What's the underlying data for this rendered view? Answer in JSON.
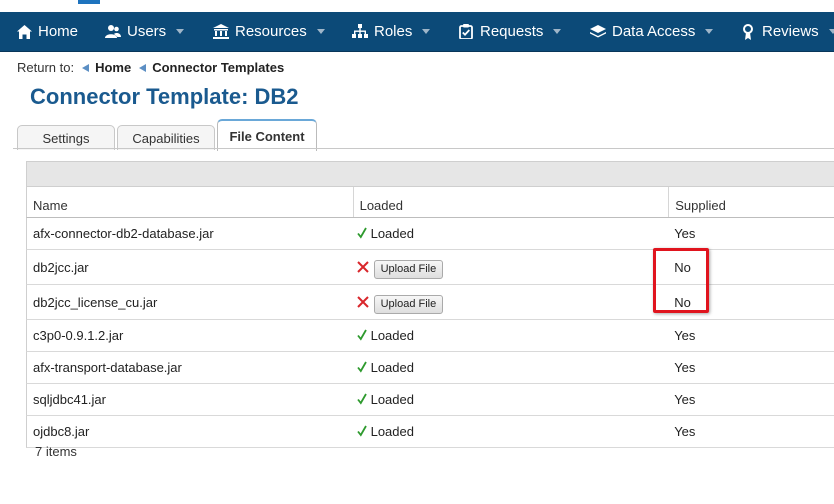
{
  "nav": {
    "items": [
      {
        "label": "Home",
        "icon": "home-icon",
        "has_caret": false
      },
      {
        "label": "Users",
        "icon": "users-icon",
        "has_caret": true
      },
      {
        "label": "Resources",
        "icon": "bank-icon",
        "has_caret": true
      },
      {
        "label": "Roles",
        "icon": "sitemap-icon",
        "has_caret": true
      },
      {
        "label": "Requests",
        "icon": "clipboard-check-icon",
        "has_caret": true
      },
      {
        "label": "Data Access",
        "icon": "layers-icon",
        "has_caret": true
      },
      {
        "label": "Reviews",
        "icon": "award-icon",
        "has_caret": true
      }
    ]
  },
  "breadcrumb": {
    "prefix": "Return to:",
    "links": [
      "Home",
      "Connector Templates"
    ]
  },
  "page": {
    "title": "Connector Template: DB2"
  },
  "tabs": [
    {
      "label": "Settings",
      "active": false
    },
    {
      "label": "Capabilities",
      "active": false
    },
    {
      "label": "File Content",
      "active": true
    }
  ],
  "table": {
    "columns": [
      "Name",
      "Loaded",
      "Supplied"
    ],
    "rows": [
      {
        "name": "afx-connector-db2-database.jar",
        "loaded": true,
        "status": "Loaded",
        "supplied": "Yes"
      },
      {
        "name": "db2jcc.jar",
        "loaded": false,
        "button": "Upload File",
        "supplied": "No"
      },
      {
        "name": "db2jcc_license_cu.jar",
        "loaded": false,
        "button": "Upload File",
        "supplied": "No"
      },
      {
        "name": "c3p0-0.9.1.2.jar",
        "loaded": true,
        "status": "Loaded",
        "supplied": "Yes"
      },
      {
        "name": "afx-transport-database.jar",
        "loaded": true,
        "status": "Loaded",
        "supplied": "Yes"
      },
      {
        "name": "sqljdbc41.jar",
        "loaded": true,
        "status": "Loaded",
        "supplied": "Yes"
      },
      {
        "name": "ojdbc8.jar",
        "loaded": true,
        "status": "Loaded",
        "supplied": "Yes"
      }
    ],
    "footer": "7 items"
  },
  "colors": {
    "nav_bg": "#0c4a78",
    "title": "#1a5a8f",
    "check": "#2e9a2e",
    "x": "#d9262b",
    "highlight": "#e0141e"
  }
}
